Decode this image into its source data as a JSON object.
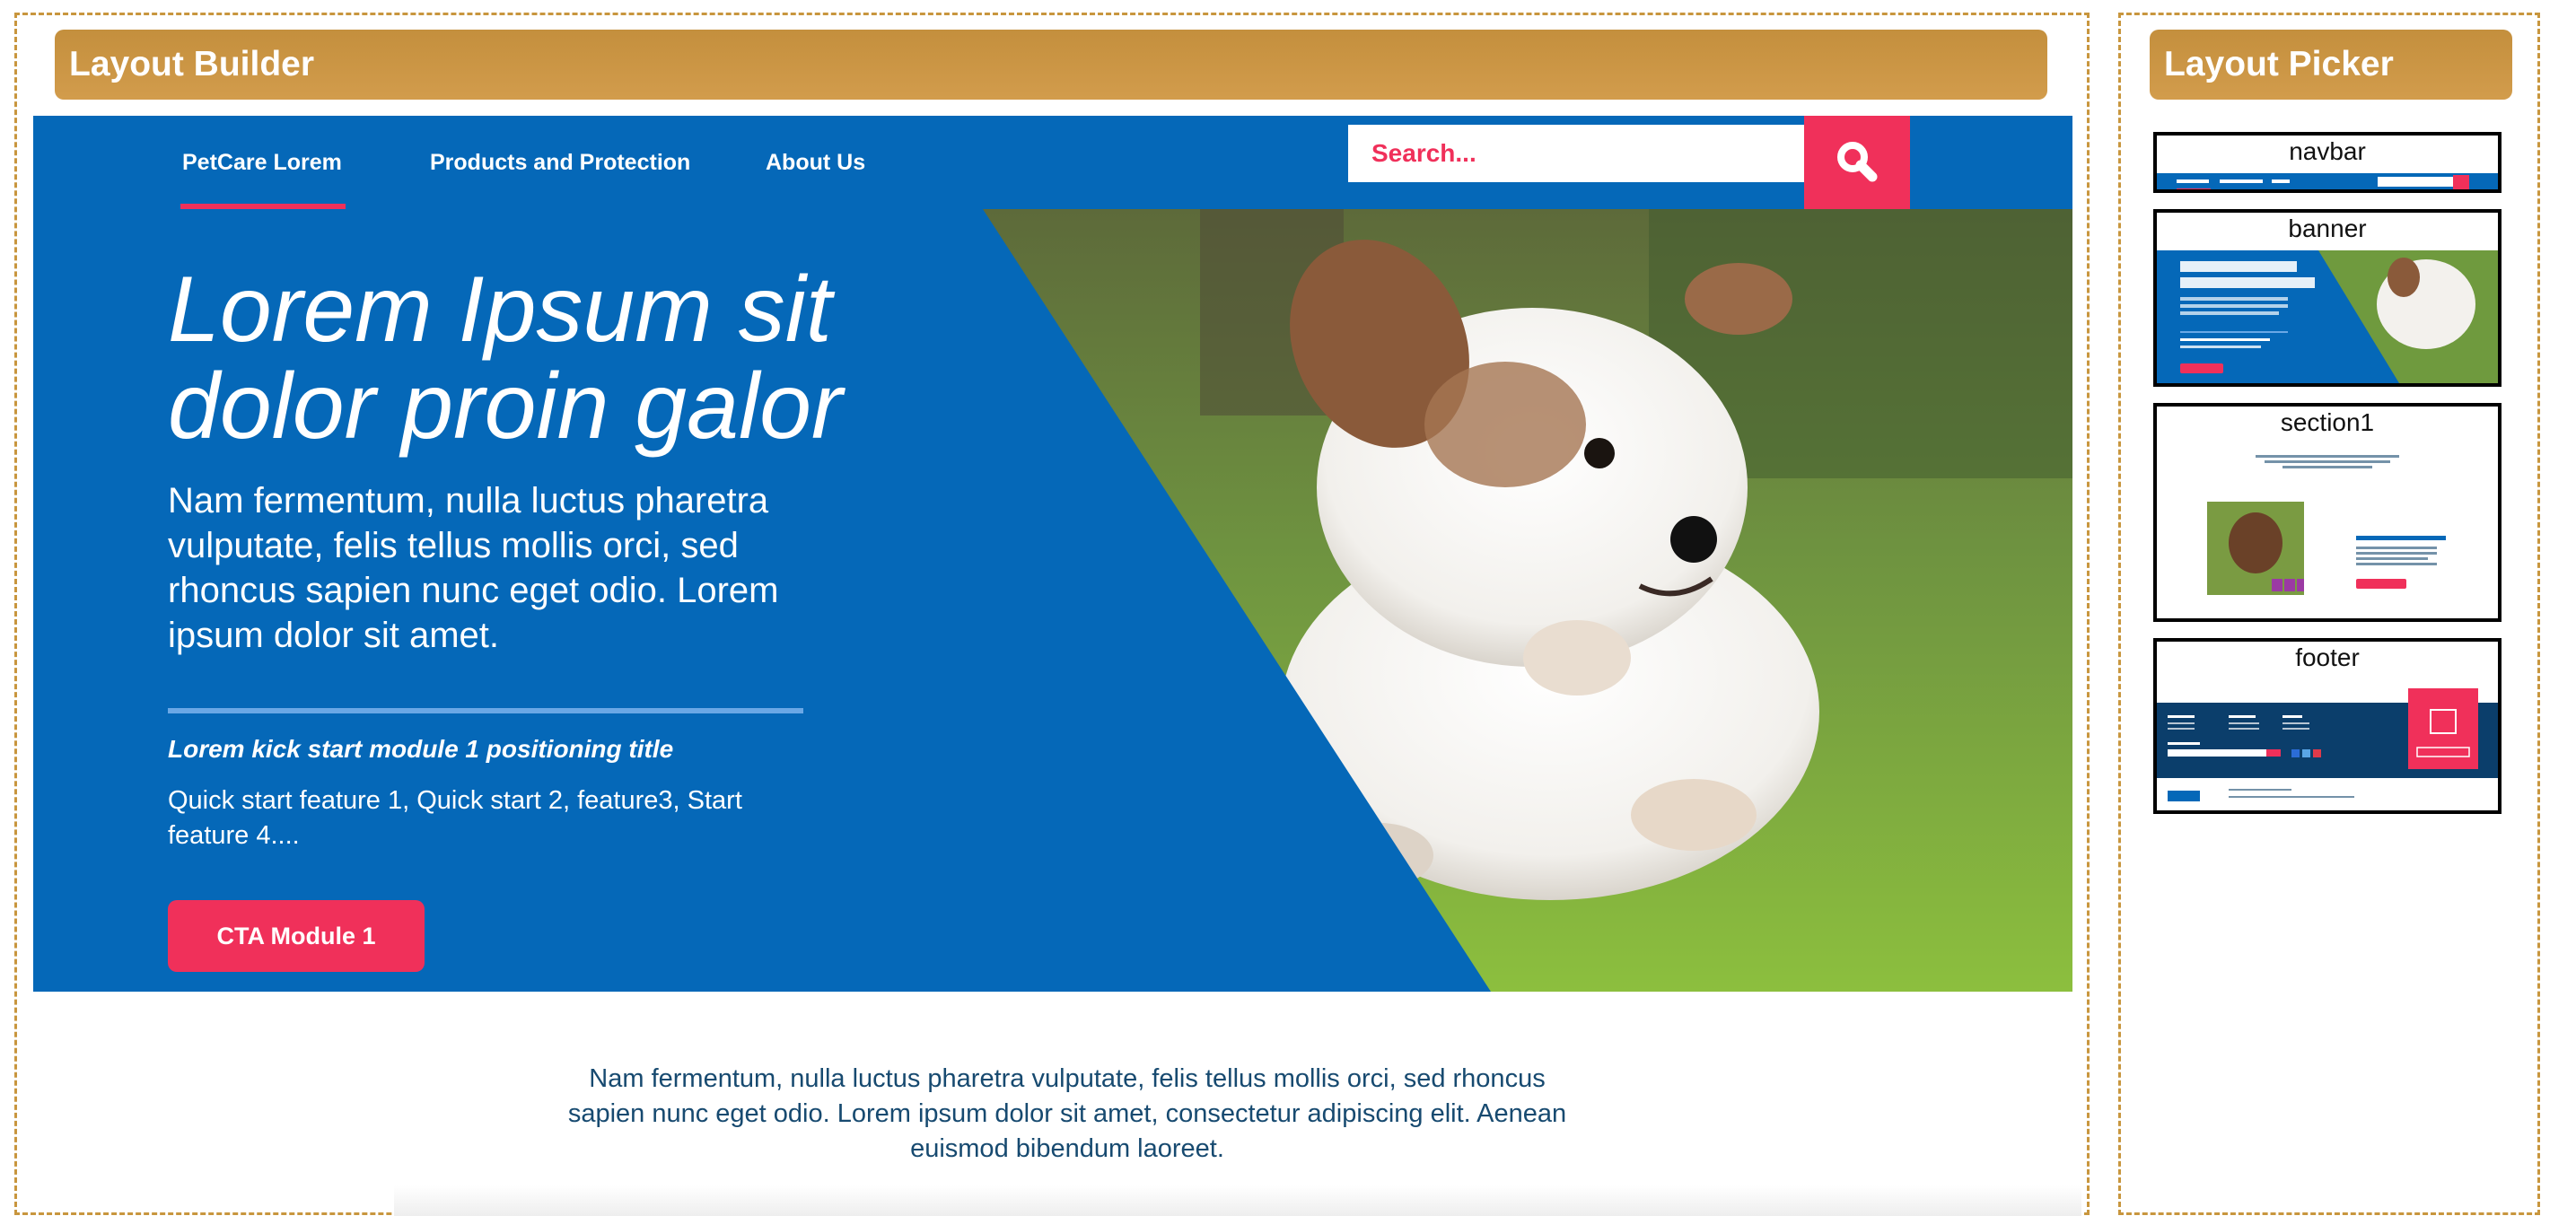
{
  "builder": {
    "title": "Layout Builder",
    "navbar": {
      "items": [
        {
          "label": "PetCare Lorem",
          "active": true
        },
        {
          "label": "Products and Protection",
          "active": false
        },
        {
          "label": "About Us",
          "active": false
        }
      ],
      "search_placeholder": "Search..."
    },
    "banner": {
      "title_line1": "Lorem Ipsum sit",
      "title_line2": "dolor proin galor",
      "text": "Nam fermentum, nulla luctus pharetra vulputate, felis tellus mollis orci, sed rhoncus sapien nunc eget odio. Lorem ipsum dolor sit amet.",
      "kick_title": "Lorem kick start module 1 positioning title",
      "features": "Quick start feature 1, Quick start 2, feature3, Start feature 4....",
      "cta": "CTA Module 1"
    },
    "intro_text": "Nam fermentum, nulla luctus pharetra vulputate, felis tellus mollis orci, sed rhoncus sapien nunc eget odio. Lorem ipsum dolor sit amet, consectetur adipiscing elit. Aenean euismod bibendum laoreet."
  },
  "picker": {
    "title": "Layout Picker",
    "cards": [
      {
        "label": "navbar"
      },
      {
        "label": "banner"
      },
      {
        "label": "section1"
      },
      {
        "label": "footer"
      }
    ]
  },
  "colors": {
    "brand_blue": "#0568b8",
    "accent_pink": "#f0305a",
    "header_gold": "#c8963e"
  },
  "icons": {
    "search": "search-icon"
  }
}
